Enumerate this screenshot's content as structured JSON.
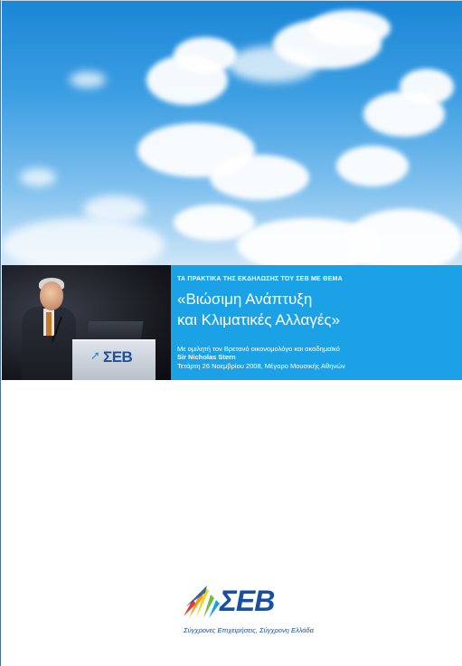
{
  "event": {
    "kicker": "ΤΑ ΠΡΑΚΤΙΚΑ ΤΗΣ ΕΚΔΗΛΩΣΗΣ ΤΟΥ ΣΕΒ ΜΕ ΘΕΜΑ",
    "title_line1": "«Βιώσιμη Ανάπτυξη",
    "title_line2": "και Κλιματικές Αλλαγές»",
    "speaker_intro": "Με ομιλητή τον Βρετανό οικονομολόγο και ακαδημαϊκό",
    "speaker_name": "Sir Nicholas Stern",
    "date_venue": "Τετάρτη 26 Νοεμβρίου 2008, Μέγαρο Μουσικής Αθηνών"
  },
  "photo": {
    "lectern_logo": "ΣΕΒ"
  },
  "logo": {
    "wordmark": "ΣΕΒ",
    "tagline": "Σύγχρονες Επιχειρήσεις, Σύγχρονη Ελλάδα",
    "icon": "seb-arrows-icon"
  },
  "colors": {
    "band_blue": "#1aa1e6",
    "logo_blue": "#1a4ea0"
  }
}
